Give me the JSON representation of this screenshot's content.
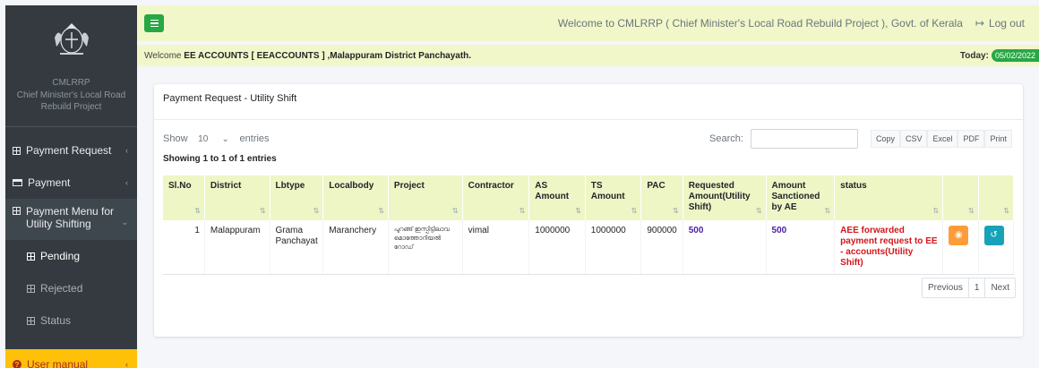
{
  "sidebar": {
    "brand_short": "CMLRRP",
    "brand_full": "Chief Minister's Local Road Rebuild Project",
    "items": [
      {
        "label": "Payment Request",
        "icon": "table-icon"
      },
      {
        "label": "Payment",
        "icon": "card-icon"
      },
      {
        "label": "Payment Menu for Utility Shifting",
        "icon": "table-icon"
      },
      {
        "label": "Pending",
        "icon": "table-icon"
      },
      {
        "label": "Rejected",
        "icon": "table-icon"
      },
      {
        "label": "Status",
        "icon": "table-icon"
      },
      {
        "label": "User manual",
        "icon": "question-icon"
      }
    ]
  },
  "topbar": {
    "welcome_text": "Welcome to CMLRRP ( Chief Minister's Local Road Rebuild Project ), Govt. of Kerala",
    "logout": "Log out"
  },
  "welcome_bar": {
    "prefix": "Welcome",
    "user": "EE ACCOUNTS   [ EEACCOUNTS ] ,Malappuram District Panchayath.",
    "today_label": "Today:",
    "today_date": "05/02/2022"
  },
  "card": {
    "title": "Payment Request - Utility Shift",
    "show_label": "Show",
    "entries_value": "10",
    "entries_label": "entries",
    "search_label": "Search:",
    "buttons": [
      "Copy",
      "CSV",
      "Excel",
      "PDF",
      "Print"
    ],
    "info": "Showing 1 to 1 of 1 entries"
  },
  "table": {
    "headers": [
      "Sl.No",
      "District",
      "Lbtype",
      "Localbody",
      "Project",
      "Contractor",
      "AS Amount",
      "TS Amount",
      "PAC",
      "Requested Amount(Utility Shift)",
      "Amount Sanctioned by AE",
      "status",
      "",
      ""
    ],
    "row": {
      "slno": "1",
      "district": "Malappuram",
      "lbtype": "Grama Panchayat",
      "localbody": "Maranchery",
      "project": "പുറങ്ങ് ഇസ്പിട്ടിലാവ മൊത്തോറിയൽ റോഡ്",
      "contractor": "vimal",
      "as_amount": "1000000",
      "ts_amount": "1000000",
      "pac": "900000",
      "requested": "500",
      "sanctioned": "500",
      "status": "AEE forwarded payment request to EE - accounts(Utility Shift)"
    }
  },
  "pagination": {
    "previous": "Previous",
    "page": "1",
    "next": "Next"
  },
  "colors": {
    "sidebar": "#343a40",
    "topbar": "#f1f7c9",
    "green": "#28a745",
    "manual": "#ffc107",
    "status_red": "#d4161b"
  }
}
